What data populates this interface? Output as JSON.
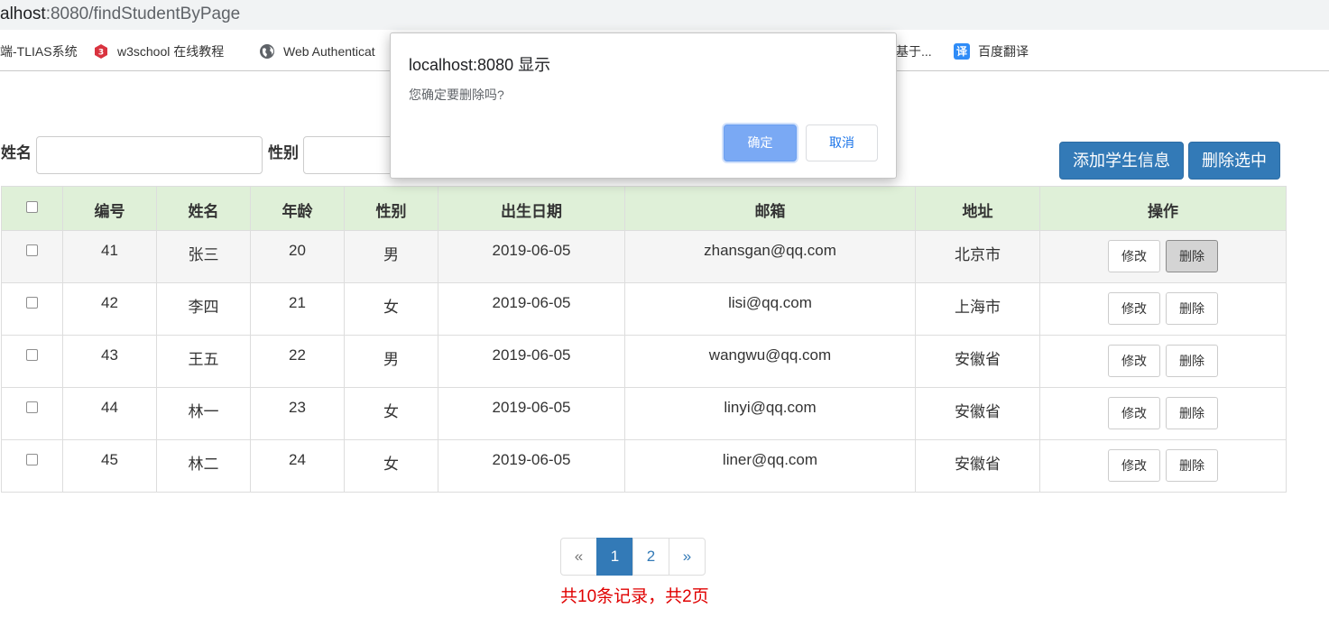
{
  "browser": {
    "url_host": "alhost",
    "url_rest": ":8080/findStudentByPage",
    "bookmarks": [
      {
        "label": "端-TLIAS系统",
        "icon": ""
      },
      {
        "label": "w3school 在线教程",
        "icon": "w3school-icon"
      },
      {
        "label": "Web Authenticat",
        "icon": "globe-icon"
      },
      {
        "label": "基于...",
        "icon": ""
      },
      {
        "label": "百度翻译",
        "icon": "translate-icon",
        "glyph": "译"
      }
    ]
  },
  "search": {
    "name_label": "姓名",
    "name_value": "",
    "gender_label": "性别",
    "gender_value": ""
  },
  "actions": {
    "add_label": "添加学生信息",
    "delete_selected_label": "删除选中"
  },
  "table": {
    "headers": [
      "",
      "编号",
      "姓名",
      "年龄",
      "性别",
      "出生日期",
      "邮箱",
      "地址",
      "操作"
    ],
    "edit_label": "修改",
    "delete_label": "删除",
    "rows": [
      {
        "id": "41",
        "name": "张三",
        "age": "20",
        "gender": "男",
        "birthday": "2019-06-05",
        "email": "zhansgan@qq.com",
        "address": "北京市"
      },
      {
        "id": "42",
        "name": "李四",
        "age": "21",
        "gender": "女",
        "birthday": "2019-06-05",
        "email": "lisi@qq.com",
        "address": "上海市"
      },
      {
        "id": "43",
        "name": "王五",
        "age": "22",
        "gender": "男",
        "birthday": "2019-06-05",
        "email": "wangwu@qq.com",
        "address": "安徽省"
      },
      {
        "id": "44",
        "name": "林一",
        "age": "23",
        "gender": "女",
        "birthday": "2019-06-05",
        "email": "linyi@qq.com",
        "address": "安徽省"
      },
      {
        "id": "45",
        "name": "林二",
        "age": "24",
        "gender": "女",
        "birthday": "2019-06-05",
        "email": "liner@qq.com",
        "address": "安徽省"
      }
    ]
  },
  "pagination": {
    "prev": "«",
    "pages": [
      "1",
      "2"
    ],
    "current": "1",
    "next": "»",
    "summary": "共10条记录，共2页"
  },
  "dialog": {
    "title": "localhost:8080 显示",
    "message": "您确定要删除吗?",
    "ok_label": "确定",
    "cancel_label": "取消"
  },
  "colors": {
    "primary": "#337ab7",
    "header_bg": "#dff0d8",
    "summary_red": "#e00000",
    "dialog_ok": "#7aa9f4"
  }
}
